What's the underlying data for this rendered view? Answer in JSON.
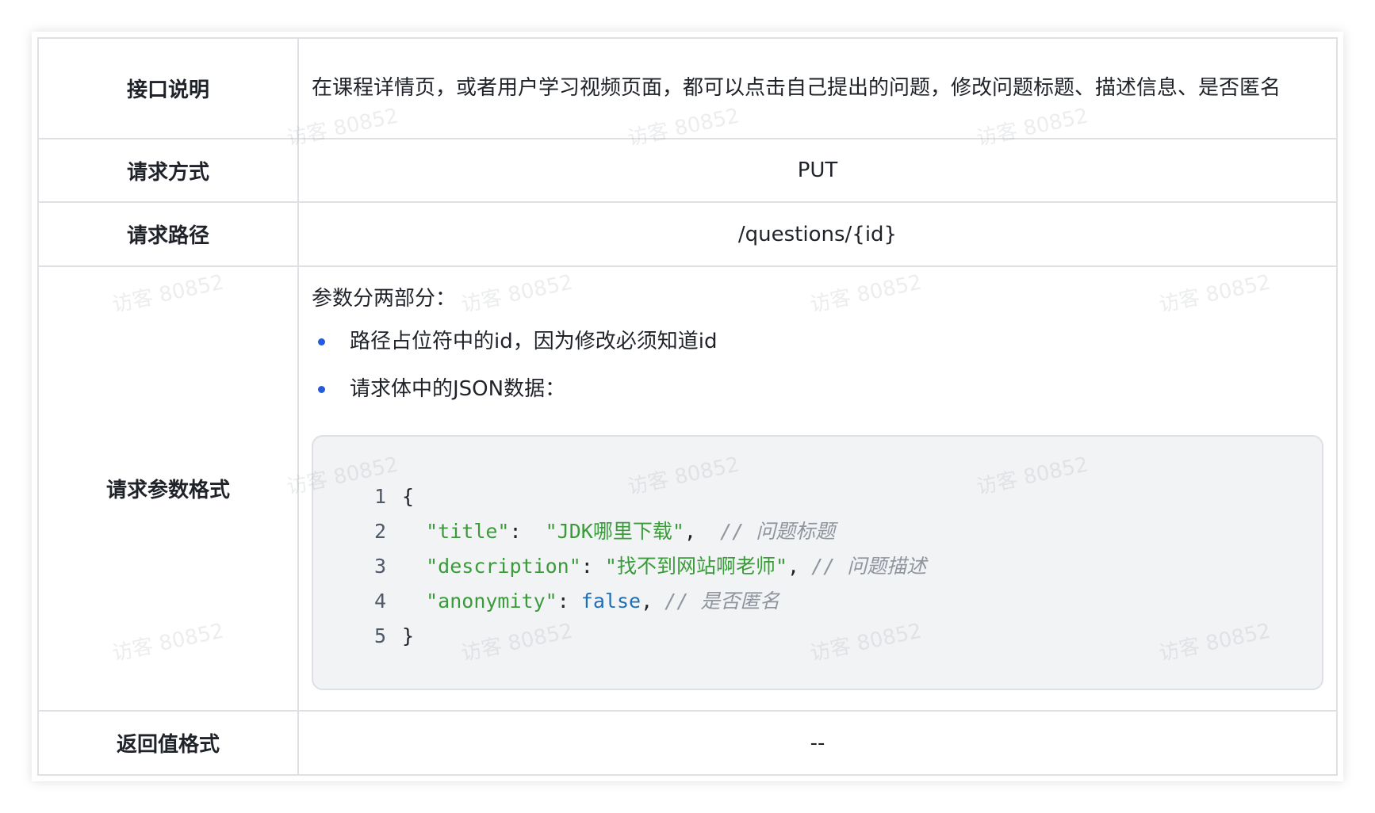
{
  "rows": {
    "description": {
      "label": "接口说明",
      "value": "在课程详情页，或者用户学习视频页面，都可以点击自己提出的问题，修改问题标题、描述信息、是否匿名"
    },
    "method": {
      "label": "请求方式",
      "value": "PUT"
    },
    "path": {
      "label": "请求路径",
      "value": "/questions/{id}"
    },
    "params": {
      "label": "请求参数格式",
      "intro": "参数分两部分：",
      "bullets": [
        "路径占位符中的id，因为修改必须知道id",
        "请求体中的JSON数据："
      ],
      "code": {
        "line_numbers": [
          "1",
          "2",
          "3",
          "4",
          "5"
        ],
        "open_brace": "{",
        "close_brace": "}",
        "title_key": "\"title\"",
        "title_value": "\"JDK哪里下载\"",
        "title_comment": "// 问题标题",
        "description_key": "\"description\"",
        "description_value": "\"找不到网站啊老师\"",
        "description_comment": "// 问题描述",
        "anonymity_key": "\"anonymity\"",
        "anonymity_value": "false",
        "anonymity_comment": "// 是否匿名"
      }
    },
    "response": {
      "label": "返回值格式",
      "value": "--"
    }
  },
  "watermark": "访客 80852",
  "colors": {
    "border": "#dee0e3",
    "bullet": "#245bdb",
    "string": "#3a9b3a",
    "keyword": "#1f6fb8",
    "comment": "#8f959e",
    "code_bg": "#f2f3f5"
  }
}
